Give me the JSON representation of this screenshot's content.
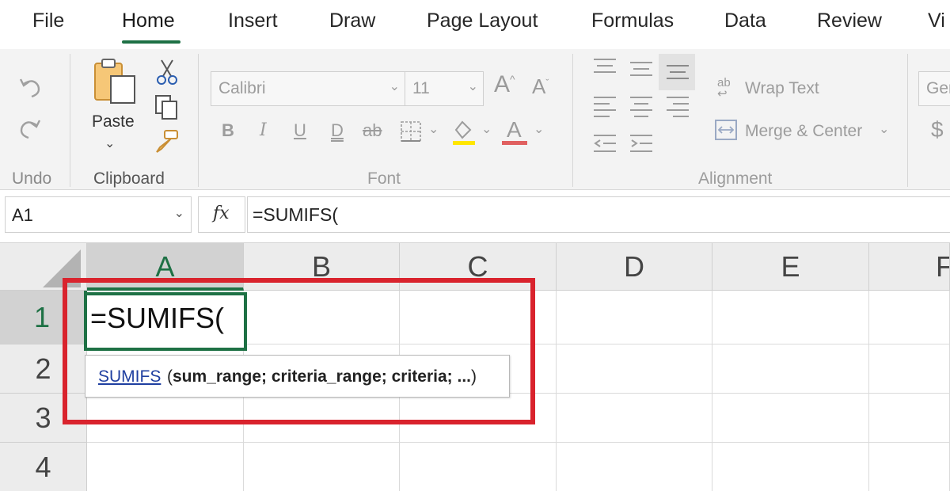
{
  "tabs": [
    {
      "label": "File",
      "active": false
    },
    {
      "label": "Home",
      "active": true
    },
    {
      "label": "Insert",
      "active": false
    },
    {
      "label": "Draw",
      "active": false
    },
    {
      "label": "Page Layout",
      "active": false
    },
    {
      "label": "Formulas",
      "active": false
    },
    {
      "label": "Data",
      "active": false
    },
    {
      "label": "Review",
      "active": false
    },
    {
      "label": "Vi",
      "active": false
    }
  ],
  "ribbon": {
    "undo": {
      "group_label": "Undo",
      "undo_icon": "undo-icon",
      "redo_icon": "redo-icon"
    },
    "clipboard": {
      "group_label": "Clipboard",
      "paste_label": "Paste",
      "icons": [
        "paste-icon",
        "cut-icon",
        "copy-icon",
        "format-painter-icon"
      ]
    },
    "font": {
      "group_label": "Font",
      "font_name": "Calibri",
      "font_size": "11",
      "increase_label": "A",
      "decrease_label": "A",
      "bold": "B",
      "italic": "I",
      "underline": "U",
      "double_underline": "D",
      "strikethrough": "ab",
      "font_color_label": "A",
      "highlight_color": "#ffe600",
      "font_color": "#e06060"
    },
    "alignment": {
      "group_label": "Alignment",
      "wrap_text_label": "Wrap Text",
      "wrap_text_icon_label": "ab",
      "merge_center_label": "Merge & Center"
    },
    "number": {
      "format_partial": "Ger",
      "currency_symbol": "$"
    }
  },
  "formula_bar": {
    "name_box": "A1",
    "fx_label": "fx",
    "formula": "=SUMIFS("
  },
  "grid": {
    "columns": [
      "A",
      "B",
      "C",
      "D",
      "E",
      "F"
    ],
    "rows": [
      "1",
      "2",
      "3",
      "4"
    ],
    "selected_column": "A",
    "selected_row": "1",
    "active_cell_value": "=SUMIFS(",
    "tooltip": {
      "function_name": "SUMIFS",
      "open_paren": "(",
      "args": "sum_range; criteria_range; criteria; ...",
      "close_paren": ")"
    }
  },
  "colors": {
    "accent_green": "#1e7145",
    "highlight_red": "#d9232d",
    "link_blue": "#1f3fa0"
  }
}
